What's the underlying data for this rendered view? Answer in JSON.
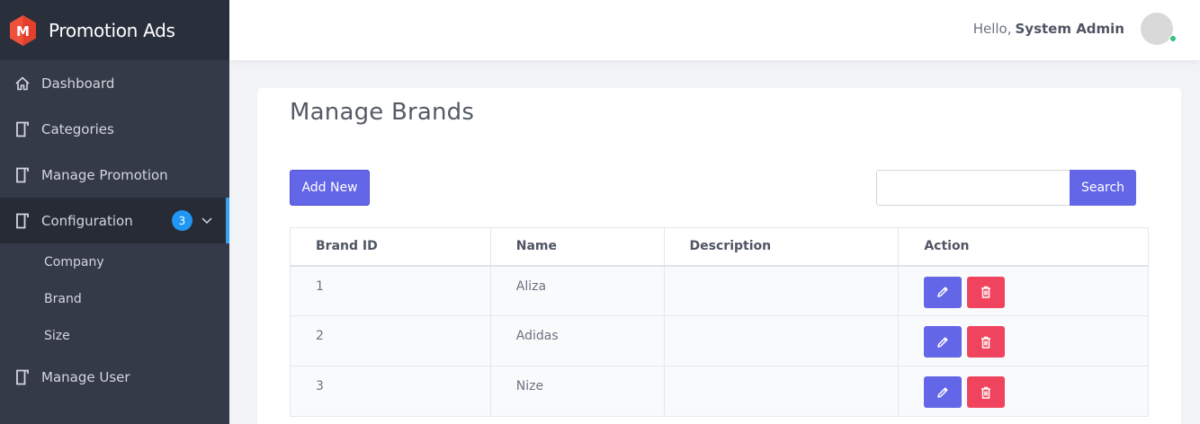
{
  "app": {
    "title": "Promotion Ads"
  },
  "colors": {
    "accent": "#6366e6",
    "danger": "#f0445e",
    "sidebar": "#343a48",
    "badge": "#2196f3",
    "online": "#2ec27e"
  },
  "sidebar": {
    "items": [
      {
        "label": "Dashboard",
        "icon": "home-icon"
      },
      {
        "label": "Categories",
        "icon": "book-icon"
      },
      {
        "label": "Manage Promotion",
        "icon": "book-icon"
      },
      {
        "label": "Configuration",
        "icon": "book-icon",
        "badge": "3",
        "expanded": true
      },
      {
        "label": "Manage User",
        "icon": "book-icon"
      }
    ],
    "subitems": [
      {
        "label": "Company"
      },
      {
        "label": "Brand"
      },
      {
        "label": "Size"
      }
    ]
  },
  "header": {
    "greeting": "Hello,",
    "user_name": "System Admin"
  },
  "main": {
    "title": "Manage Brands",
    "add_label": "Add New",
    "search": {
      "placeholder": "",
      "button_label": "Search"
    },
    "table": {
      "columns": [
        "Brand ID",
        "Name",
        "Description",
        "Action"
      ],
      "rows": [
        {
          "id": "1",
          "name": "Aliza",
          "description": ""
        },
        {
          "id": "2",
          "name": "Adidas",
          "description": ""
        },
        {
          "id": "3",
          "name": "Nize",
          "description": ""
        }
      ]
    }
  }
}
